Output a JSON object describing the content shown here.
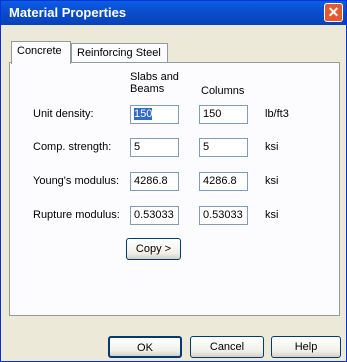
{
  "window": {
    "title": "Material Properties"
  },
  "tabs": [
    {
      "label": "Concrete",
      "active": true
    },
    {
      "label": "Reinforcing Steel",
      "active": false
    }
  ],
  "columns": {
    "slabs_line1": "Slabs and",
    "slabs_line2": "Beams",
    "columns": "Columns"
  },
  "rows": [
    {
      "label": "Unit density:",
      "slabs": "150",
      "columns": "150",
      "unit": "lb/ft3"
    },
    {
      "label": "Comp. strength:",
      "slabs": "5",
      "columns": "5",
      "unit": "ksi"
    },
    {
      "label": "Young's modulus:",
      "slabs": "4286.8",
      "columns": "4286.8",
      "unit": "ksi"
    },
    {
      "label": "Rupture modulus:",
      "slabs": "0.53033",
      "columns": "0.53033",
      "unit": "ksi"
    }
  ],
  "copy_button": "Copy >",
  "buttons": {
    "ok": "OK",
    "cancel": "Cancel",
    "help": "Help"
  },
  "colors": {
    "titlebar": "#0B4FD2",
    "selection": "#316AC5",
    "face": "#ECE9D8"
  }
}
